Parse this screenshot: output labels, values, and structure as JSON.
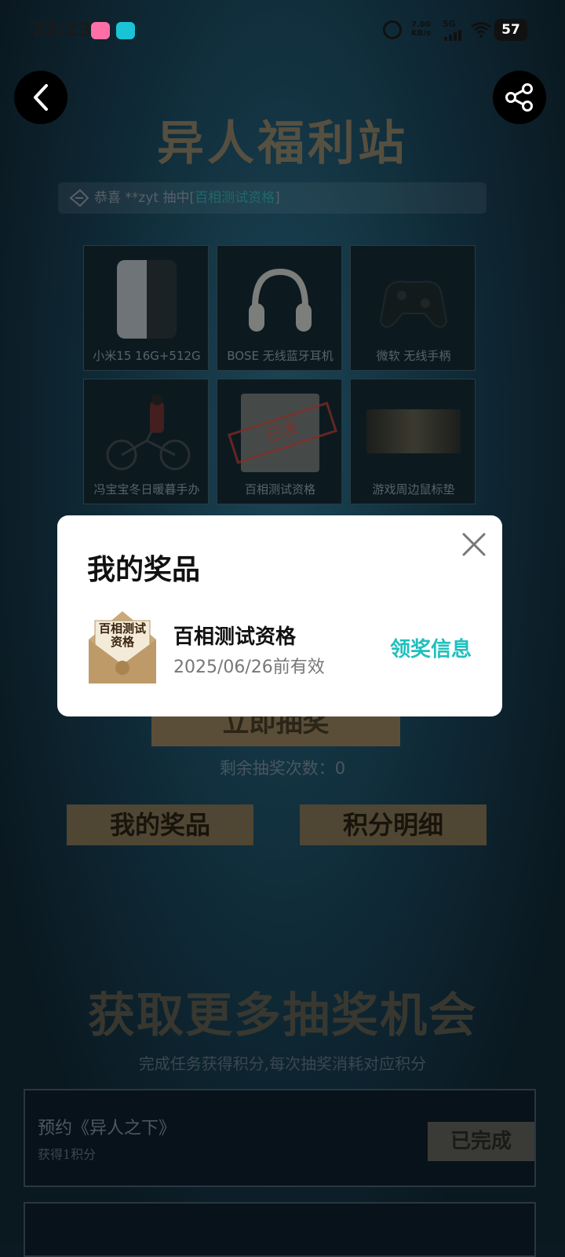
{
  "status_bar": {
    "time": "22:23",
    "net_speed": "7.00\nKB/s",
    "network": "5G",
    "battery": "57"
  },
  "page": {
    "title": "异人福利站",
    "ticker": {
      "prefix": "恭喜 **zyt 抽中[",
      "highlight": "百相测试资格",
      "suffix": "]"
    },
    "prizes": [
      {
        "label": "小米15 16G+512G"
      },
      {
        "label": "BOSE 无线蓝牙耳机"
      },
      {
        "label": "微软 无线手柄"
      },
      {
        "label": "冯宝宝冬日暖暮手办"
      },
      {
        "label": "百相测试资格"
      },
      {
        "label": "游戏周边鼠标垫"
      }
    ],
    "draw_button": "立即抽奖",
    "remaining": "剩余抽奖次数：0",
    "my_prizes_button": "我的奖品",
    "points_button": "积分明细",
    "more_title": "获取更多抽奖机会",
    "more_subtitle": "完成任务获得积分,每次抽奖消耗对应积分",
    "tasks": [
      {
        "name": "预约《异人之下》",
        "desc": "获得1积分",
        "status": "已完成"
      }
    ]
  },
  "modal": {
    "title": "我的奖品",
    "prize_name": "百相测试资格",
    "prize_valid": "2025/06/26前有效",
    "claim_link": "领奖信息",
    "thumb_text": "百相测试\n资格"
  },
  "colors": {
    "accent": "#1fc0bd",
    "background": "#0f2a37"
  }
}
